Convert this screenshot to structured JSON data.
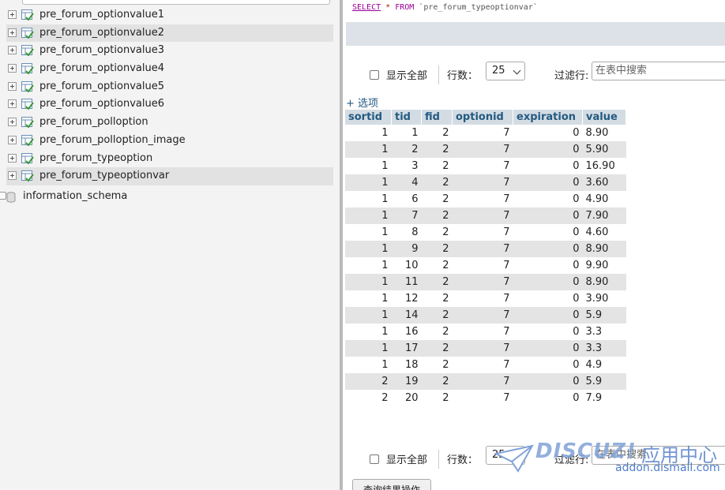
{
  "nav": {
    "tables": [
      {
        "label": "pre_forum_optionvalue1",
        "highlighted": false
      },
      {
        "label": "pre_forum_optionvalue2",
        "highlighted": true
      },
      {
        "label": "pre_forum_optionvalue3",
        "highlighted": false
      },
      {
        "label": "pre_forum_optionvalue4",
        "highlighted": false
      },
      {
        "label": "pre_forum_optionvalue5",
        "highlighted": false
      },
      {
        "label": "pre_forum_optionvalue6",
        "highlighted": false
      },
      {
        "label": "pre_forum_polloption",
        "highlighted": false
      },
      {
        "label": "pre_forum_polloption_image",
        "highlighted": false
      },
      {
        "label": "pre_forum_typeoption",
        "highlighted": false
      },
      {
        "label": "pre_forum_typeoptionvar",
        "highlighted": true
      }
    ],
    "database": "information_schema"
  },
  "sql": {
    "select": "SELECT",
    "star": "*",
    "from": "FROM",
    "table": "`pre_forum_typeoptionvar`"
  },
  "navbar": {
    "show_all": "显示全部",
    "rows_label": "行数：",
    "rows_value": "25",
    "filter_label": "过滤行:",
    "filter_placeholder": "在表中搜索"
  },
  "options_link": "+ 选项",
  "table": {
    "columns": [
      "sortid",
      "tid",
      "fid",
      "optionid",
      "expiration",
      "value"
    ],
    "rows": [
      [
        "1",
        "1",
        "2",
        "7",
        "0",
        "8.90"
      ],
      [
        "1",
        "2",
        "2",
        "7",
        "0",
        "5.90"
      ],
      [
        "1",
        "3",
        "2",
        "7",
        "0",
        "16.90"
      ],
      [
        "1",
        "4",
        "2",
        "7",
        "0",
        "3.60"
      ],
      [
        "1",
        "6",
        "2",
        "7",
        "0",
        "4.90"
      ],
      [
        "1",
        "7",
        "2",
        "7",
        "0",
        "7.90"
      ],
      [
        "1",
        "8",
        "2",
        "7",
        "0",
        "4.60"
      ],
      [
        "1",
        "9",
        "2",
        "7",
        "0",
        "8.90"
      ],
      [
        "1",
        "10",
        "2",
        "7",
        "0",
        "9.90"
      ],
      [
        "1",
        "11",
        "2",
        "7",
        "0",
        "8.90"
      ],
      [
        "1",
        "12",
        "2",
        "7",
        "0",
        "3.90"
      ],
      [
        "1",
        "14",
        "2",
        "7",
        "0",
        "5.9"
      ],
      [
        "1",
        "16",
        "2",
        "7",
        "0",
        "3.3"
      ],
      [
        "1",
        "17",
        "2",
        "7",
        "0",
        "3.3"
      ],
      [
        "1",
        "18",
        "2",
        "7",
        "0",
        "4.9"
      ],
      [
        "2",
        "19",
        "2",
        "7",
        "0",
        "5.9"
      ],
      [
        "2",
        "20",
        "2",
        "7",
        "0",
        "7.9"
      ]
    ]
  },
  "bottom_navbar": {
    "show_all": "显示全部",
    "rows_label": "行数：",
    "rows_value": "25",
    "filter_label": "过滤行:",
    "filter_placeholder": "在表中搜索"
  },
  "query_ops_button": "查询结果操作",
  "watermark": {
    "brand": "DISCUZ!",
    "cn": "应用中心",
    "domain": "addon.dismall.com"
  },
  "colors": {
    "header_bg": "#d3dce3",
    "header_text": "#235a81",
    "row_alt": "#e4e4e4",
    "sql_keyword": "#990099"
  }
}
